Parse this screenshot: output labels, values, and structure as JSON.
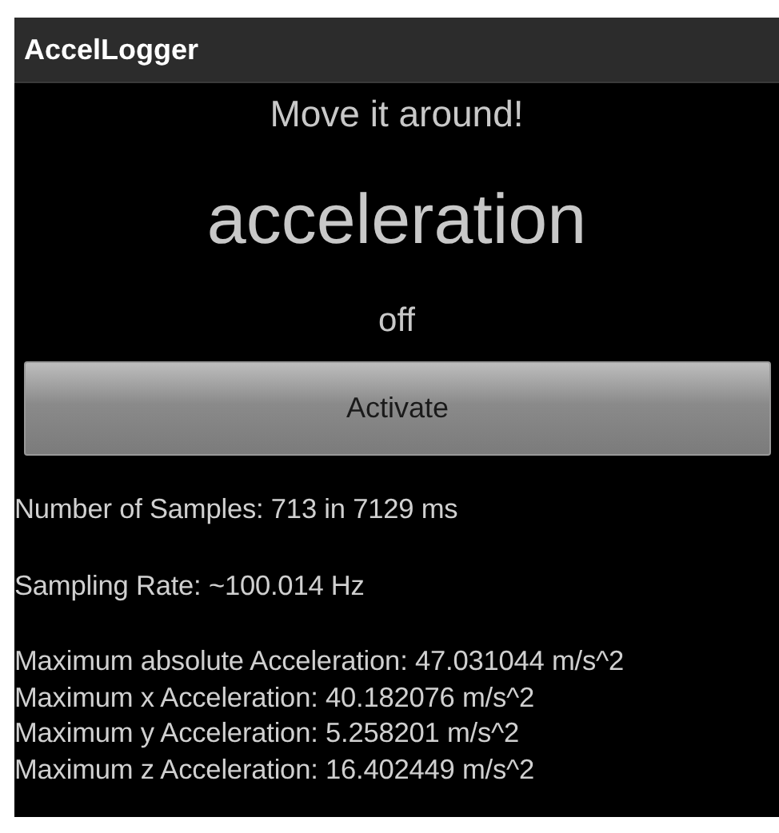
{
  "window": {
    "title": "AccelLogger"
  },
  "prompt": "Move it around!",
  "heading": "acceleration",
  "status": "off",
  "button": "Activate",
  "stats": [
    {
      "lines": [
        "Number of Samples: 713 in 7129 ms"
      ]
    },
    {
      "lines": [
        "Sampling Rate: ~100.014 Hz"
      ]
    },
    {
      "lines": [
        "Maximum absolute Acceleration: 47.031044 m/s^2",
        "Maximum x Acceleration: 40.182076 m/s^2",
        "Maximum y Acceleration: 5.258201 m/s^2",
        "Maximum z Acceleration: 16.402449 m/s^2"
      ]
    }
  ]
}
